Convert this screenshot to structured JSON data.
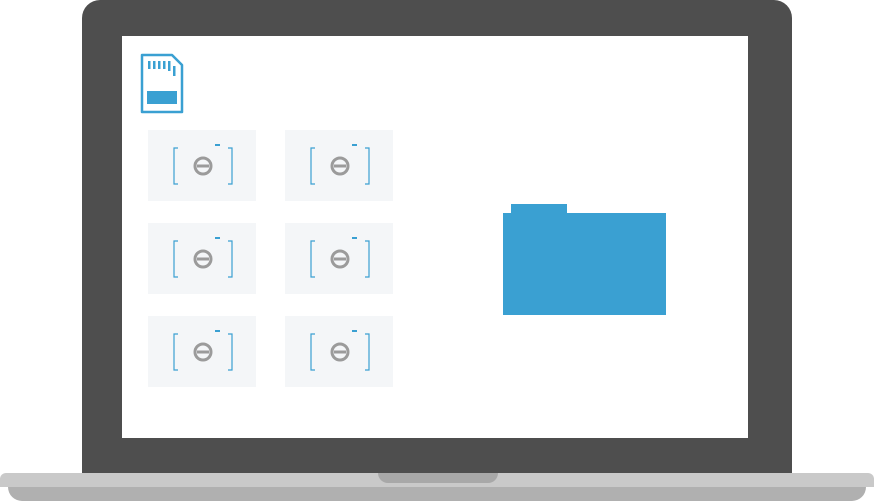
{
  "colors": {
    "lid": "#4e4e4e",
    "accent_blue": "#3aa0d2",
    "thumb_bg": "#f4f6f8",
    "lens_gray": "#9b9b9b"
  },
  "icons": {
    "storage": "sd-card-icon",
    "photo": "camera-icon",
    "destination": "folder-icon"
  },
  "thumbnails": [
    {
      "name": "photo-1"
    },
    {
      "name": "photo-2"
    },
    {
      "name": "photo-3"
    },
    {
      "name": "photo-4"
    },
    {
      "name": "photo-5"
    },
    {
      "name": "photo-6"
    }
  ]
}
